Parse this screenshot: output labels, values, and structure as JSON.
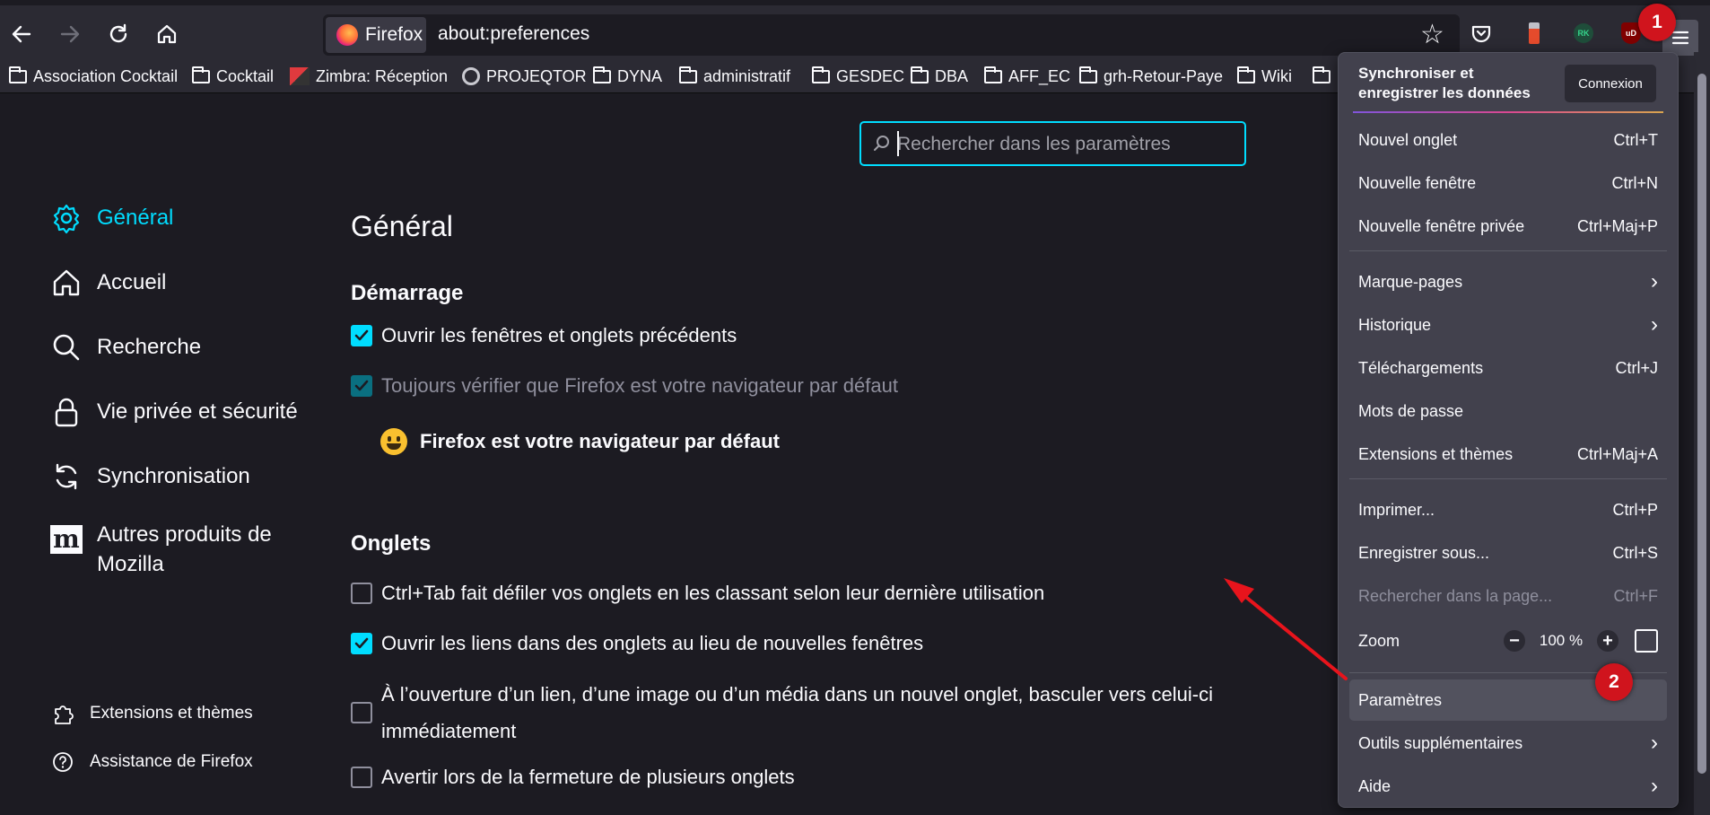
{
  "toolbar": {
    "identity_label": "Firefox",
    "url": "about:preferences"
  },
  "bookmarks": [
    {
      "label": "Association Cocktail",
      "icon": "folder-icon"
    },
    {
      "label": "Cocktail",
      "icon": "folder-icon"
    },
    {
      "label": "Zimbra: Réception",
      "icon": "zimbra-icon"
    },
    {
      "label": "PROJEQTOR",
      "icon": "projeqtor-icon"
    },
    {
      "label": "DYNA",
      "icon": "folder-icon"
    },
    {
      "label": "administratif",
      "icon": "folder-icon"
    },
    {
      "label": "GESDEC",
      "icon": "folder-icon"
    },
    {
      "label": "DBA",
      "icon": "folder-icon"
    },
    {
      "label": "AFF_EC",
      "icon": "folder-icon"
    },
    {
      "label": "grh-Retour-Paye",
      "icon": "folder-icon"
    },
    {
      "label": "Wiki",
      "icon": "folder-icon"
    }
  ],
  "search": {
    "placeholder": "Rechercher dans les paramètres"
  },
  "sidebar": {
    "categories": [
      {
        "label": "Général",
        "icon": "gear-icon",
        "selected": true
      },
      {
        "label": "Accueil",
        "icon": "home-icon",
        "selected": false
      },
      {
        "label": "Recherche",
        "icon": "search-icon",
        "selected": false
      },
      {
        "label": "Vie privée et sécurité",
        "icon": "lock-icon",
        "selected": false
      },
      {
        "label": "Synchronisation",
        "icon": "sync-icon",
        "selected": false
      },
      {
        "label": "Autres produits de Mozilla",
        "icon": "mozilla-icon",
        "selected": false
      }
    ],
    "footer": [
      {
        "label": "Extensions et thèmes",
        "icon": "puzzle-icon"
      },
      {
        "label": "Assistance de Firefox",
        "icon": "help-icon"
      }
    ]
  },
  "main": {
    "title": "Général",
    "startup_heading": "Démarrage",
    "startup_options": [
      {
        "label": "Ouvrir les fenêtres et onglets précédents",
        "checked": true,
        "disabled": false
      },
      {
        "label": "Toujours vérifier que Firefox est votre navigateur par défaut",
        "checked": true,
        "disabled": true
      }
    ],
    "default_browser_text": "Firefox est votre navigateur par défaut",
    "tabs_heading": "Onglets",
    "tabs_options": [
      {
        "label": "Ctrl+Tab fait défiler vos onglets en les classant selon leur dernière utilisation",
        "checked": false
      },
      {
        "label": "Ouvrir les liens dans des onglets au lieu de nouvelles fenêtres",
        "checked": true
      },
      {
        "label_line1": "À l’ouverture d’un lien, d’une image ou d’un média dans un nouvel onglet, basculer vers celui-ci",
        "label_line2": "immédiatement",
        "checked": false
      },
      {
        "label": "Avertir lors de la fermeture de plusieurs onglets",
        "checked": false
      }
    ]
  },
  "menu": {
    "sync_line1": "Synchroniser et",
    "sync_line2": "enregistrer les données",
    "connexion": "Connexion",
    "items": [
      {
        "label": "Nouvel onglet",
        "shortcut": "Ctrl+T"
      },
      {
        "label": "Nouvelle fenêtre",
        "shortcut": "Ctrl+N"
      },
      {
        "label": "Nouvelle fenêtre privée",
        "shortcut": "Ctrl+Maj+P"
      },
      {
        "label": "Marque-pages",
        "shortcut": ""
      },
      {
        "label": "Historique",
        "shortcut": ""
      },
      {
        "label": "Téléchargements",
        "shortcut": "Ctrl+J"
      },
      {
        "label": "Mots de passe",
        "shortcut": ""
      },
      {
        "label": "Extensions et thèmes",
        "shortcut": "Ctrl+Maj+A"
      },
      {
        "label": "Imprimer...",
        "shortcut": "Ctrl+P"
      },
      {
        "label": "Enregistrer sous...",
        "shortcut": "Ctrl+S"
      },
      {
        "label": "Rechercher dans la page...",
        "shortcut": "Ctrl+F"
      },
      {
        "label": "Zoom",
        "shortcut": ""
      },
      {
        "label": "Paramètres",
        "shortcut": ""
      },
      {
        "label": "Outils supplémentaires",
        "shortcut": ""
      },
      {
        "label": "Aide",
        "shortcut": ""
      }
    ],
    "zoom_value": "100 %",
    "zoom_minus": "−",
    "zoom_plus": "+"
  },
  "annotations": {
    "badge1": "1",
    "badge2": "2"
  },
  "colors": {
    "accent": "#00ddff",
    "badge": "#d0141d",
    "arrow": "#e8141c"
  }
}
